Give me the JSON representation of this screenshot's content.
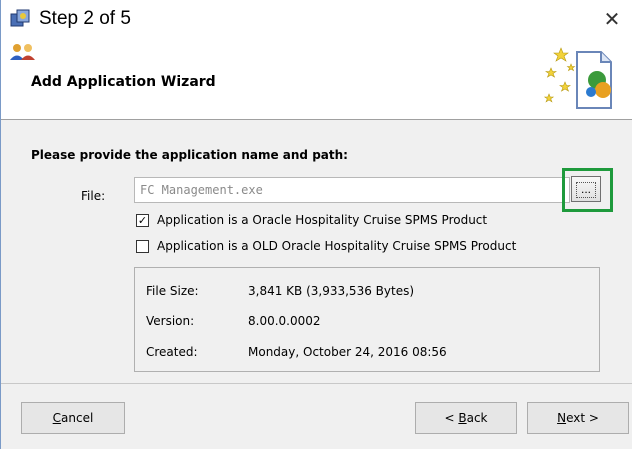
{
  "window": {
    "title": "Step 2 of 5",
    "close_glyph": "✕"
  },
  "header": {
    "title": "Add Application Wizard"
  },
  "form": {
    "prompt": "Please provide the application name and path:",
    "file_label": "File:",
    "file_value": "FC Management.exe",
    "browse_label": "...",
    "checkboxes": [
      {
        "label": "Application is a Oracle Hospitality Cruise SPMS Product",
        "checked": true,
        "mark": "✓"
      },
      {
        "label": "Application is a OLD Oracle Hospitality Cruise SPMS Product",
        "checked": false,
        "mark": ""
      }
    ]
  },
  "info": {
    "rows": [
      {
        "label": "File Size:",
        "value": "3,841 KB (3,933,536 Bytes)"
      },
      {
        "label": "Version:",
        "value": "8.00.0.0002"
      },
      {
        "label": "Created:",
        "value": "Monday, October 24, 2016 08:56"
      }
    ]
  },
  "buttons": {
    "cancel": {
      "prefix": "",
      "mnemonic": "C",
      "rest": "ancel"
    },
    "back": {
      "prefix": "< ",
      "mnemonic": "B",
      "rest": "ack"
    },
    "next": {
      "prefix": "",
      "mnemonic": "N",
      "rest": "ext >"
    }
  },
  "colors": {
    "highlight": "#1e9a3c",
    "window_bg": "#f0f0f0",
    "header_bg": "#ffffff"
  },
  "icons": {
    "app": "setup-wizard-icon",
    "users": "users-icon",
    "wizard_art": "wizard-stars-document-icon",
    "close": "close-icon"
  }
}
